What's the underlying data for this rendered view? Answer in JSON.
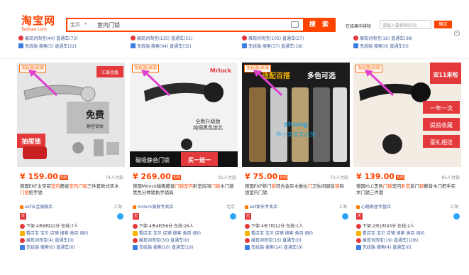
{
  "header": {
    "logo": "淘宝网",
    "logo_sub": "Taobao.com",
    "search_type": "宝贝",
    "search_query": "室内门锁",
    "search_button": "搜 索",
    "refine_label": "在结果中排除",
    "refine_placeholder": "请输入要排除的词",
    "refine_button": "确定"
  },
  "top_rows": [
    {
      "l1": "展现词淘宝(44) 直通车(73)",
      "l2": "无线端 搜索(5) 直通车(22)"
    },
    {
      "l1": "展现词淘宝(135) 直通车(51)",
      "l2": "无线端 搜索(64) 直通车(32)"
    },
    {
      "l1": "展现词淘宝(105) 直通车(27)",
      "l2": "无线端 搜索(37) 直通车(18)"
    },
    {
      "l1": "展现词淘宝(16) 直通车(38)",
      "l2": "无线端 搜索(0) 直通车(0)"
    }
  ],
  "products": [
    {
      "tag": "淘抢购|抢购",
      "price": "¥ 159.00",
      "baoyou": "包邮",
      "paid": "74人付款",
      "title_a": "德国EKF太空铝",
      "title_hl1": "室内",
      "title_b": "静音",
      "title_hl2": "室内门锁",
      "title_c": "三件套欧式实木",
      "title_hl3": "门锁",
      "title_d": "把手锁",
      "shop": "ekf五金旗舰店",
      "loc": "上海",
      "ext1": "下架:4天8时22分 在线:7人",
      "ext2": "看店宝 宝贝 店铺 搜索 类目 调价",
      "ext3": "展现词淘宝(4) 直通车(0)",
      "ext4": "无线端 搜索(0) 直通车(0)",
      "img_text1": "免费",
      "img_text2": "静音锁体",
      "img_text3": "抽屉锁",
      "img_brand": "汇泰金盾"
    },
    {
      "tag": "淘抢购|抢购",
      "price": "¥ 269.00",
      "baoyou": "包邮",
      "paid": "91人付款",
      "title_a": "德国Mrlock磁吸静音",
      "title_hl1": "门锁",
      "title_b": "",
      "title_hl2": "室内",
      "title_c": "卧室房间",
      "title_hl3": "门锁",
      "title_d": "木门锁黑色分体锁执手锁具",
      "shop": "mrlock旗舰专卖店",
      "loc": "北京",
      "ext1": "下架:4天4时56分 在线:26人",
      "ext2": "看店宝 宝贝 店铺 搜索 类目 调价",
      "ext3": "展现词淘宝(30) 直通车(0)",
      "ext4": "无线端 搜索(10) 直通车(19)",
      "img_text1": "磁吸静音门锁",
      "img_text2": "买一送一",
      "img_brand": "Mrlock"
    },
    {
      "tag": "淘抢购|抢购",
      "price": "¥ 75.00",
      "baoyou": "包邮",
      "paid": "72人付款",
      "title_a": "德国EKF移门",
      "title_hl1": "锁",
      "title_b": "锌合金实木推拉",
      "title_hl2": "门",
      "title_c": "卫生间厨房",
      "title_hl3": "锁",
      "title_d": "钩锁室内门锁",
      "shop": "ekf家东专卖店",
      "loc": "上海",
      "ext1": "下架:4天7时12分 在线:1人",
      "ext2": "看店宝 宝贝 店铺 搜索 类目 调价",
      "ext3": "展现词淘宝(16) 直通车(0)",
      "ext4": "无线端 搜索(14) 直通车(0)",
      "img_text1": "适配百搭",
      "img_text2": "多色可选"
    },
    {
      "tag": "淘抢购|抢购",
      "price": "¥ 139.00",
      "baoyou": "包邮",
      "paid": "85人付款",
      "title_a": "德国KLC黑色",
      "title_hl1": "门锁",
      "title_b": "室内",
      "title_hl2": "卧室",
      "title_c": "房门",
      "title_hl3": "锁",
      "title_d": "静音木门把手实木门锁三件套",
      "shop": "心踏家居专营店",
      "loc": "上海",
      "ext1": "下架:2天1时43分 在线:2人",
      "ext2": "看店宝 宝贝 店铺 搜索 类目 调价",
      "ext3": "展现词淘宝(19) 直通车(106)",
      "ext4": "无线端 搜索(4) 直通车(0)",
      "img_text1": "双11来啦",
      "img_text2": "一年一次",
      "img_text3": "提前收藏",
      "img_text4": "豪礼相送"
    }
  ],
  "watermark": {
    "line1": "全新升级版",
    "line2": "纯铜黑色锁芯",
    "line3": "zhong",
    "line4": "中小卖家实战营"
  },
  "colors": {
    "accent": "#ff4400",
    "link": "#3b5998"
  }
}
